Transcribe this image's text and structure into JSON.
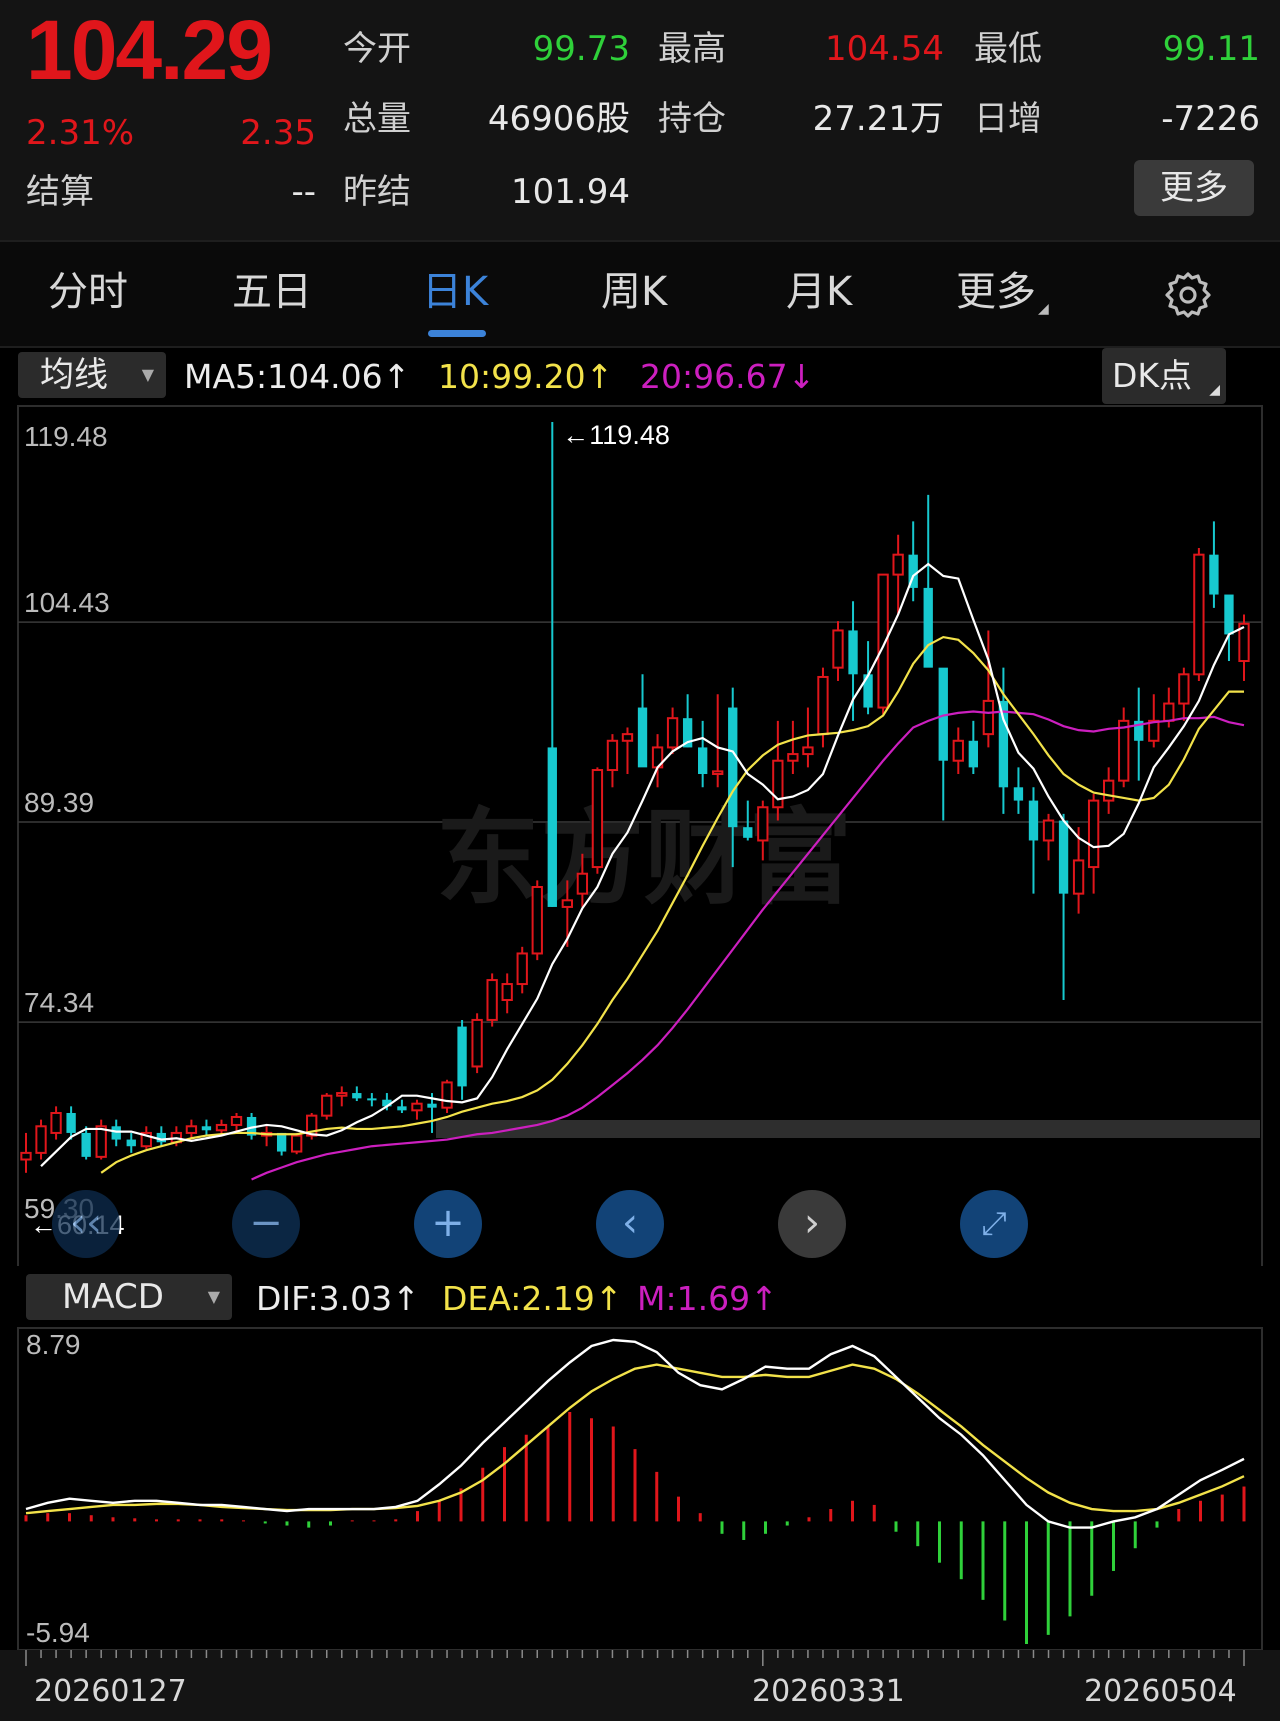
{
  "quote": {
    "price": "104.29",
    "change_pct": "2.31%",
    "change": "2.35",
    "open_label": "今开",
    "open": "99.73",
    "high_label": "最高",
    "high": "104.54",
    "low_label": "最低",
    "low": "99.11",
    "volume_label": "总量",
    "volume": "46906股",
    "position_label": "持仓",
    "position": "27.21万",
    "daily_inc_label": "日增",
    "daily_inc": "-7226",
    "settle_label": "结算",
    "settle": "--",
    "prev_settle_label": "昨结",
    "prev_settle": "101.94",
    "more_label": "更多"
  },
  "tabs": [
    {
      "label": "分时"
    },
    {
      "label": "五日"
    },
    {
      "label": "日K"
    },
    {
      "label": "周K"
    },
    {
      "label": "月K"
    },
    {
      "label": "更多"
    }
  ],
  "active_tab": "日K",
  "indicators": {
    "ma_select": "均线",
    "ma5": "MA5:104.06↑",
    "ma10": "10:99.20↑",
    "ma20": "20:96.67↓",
    "dk_label": "DK点",
    "macd_select": "MACD",
    "dif": "DIF:3.03↑",
    "dea": "DEA:2.19↑",
    "m": "M:1.69↑"
  },
  "price_axis": [
    "119.48",
    "104.43",
    "89.39",
    "74.34",
    "59.30"
  ],
  "macd_axis": [
    "8.79",
    "-5.94"
  ],
  "annotations": {
    "max_marker": "←119.48",
    "min_marker": "←60.14"
  },
  "dates": [
    "20260127",
    "20260331",
    "20260504"
  ],
  "colors": {
    "up": "#e0161b",
    "down": "#2fd13a",
    "cyan": "#17c9cf",
    "ma5": "#ffffff",
    "ma10": "#f2e24a",
    "ma20": "#cc1fbf",
    "accent": "#3c83d9"
  },
  "chart_data": [
    {
      "type": "candlestick",
      "title": "",
      "ylim": [
        59.3,
        119.48
      ],
      "candles": [
        [
          64,
          66,
          63,
          64.5
        ],
        [
          64.5,
          67,
          64,
          66.5
        ],
        [
          66,
          68,
          65.5,
          67.5
        ],
        [
          67.5,
          68,
          65.5,
          66
        ],
        [
          66,
          66.5,
          64,
          64.2
        ],
        [
          64.2,
          67,
          64,
          66.5
        ],
        [
          66.5,
          67,
          65,
          65.5
        ],
        [
          65.5,
          66,
          64.5,
          65
        ],
        [
          65,
          66.5,
          64.8,
          66
        ],
        [
          66,
          66.5,
          65,
          65.3
        ],
        [
          65.3,
          66.5,
          65,
          66
        ],
        [
          66,
          67,
          65.5,
          66.5
        ],
        [
          66.5,
          67,
          65.8,
          66.2
        ],
        [
          66.2,
          67,
          65.8,
          66.6
        ],
        [
          66.6,
          67.5,
          66,
          67.2
        ],
        [
          67.2,
          67.5,
          65.5,
          65.8
        ],
        [
          65.8,
          66.5,
          65,
          66
        ],
        [
          66,
          66,
          64.3,
          64.6
        ],
        [
          64.6,
          66,
          64.4,
          65.8
        ],
        [
          65.8,
          67.5,
          65.5,
          67.3
        ],
        [
          67.3,
          69,
          67,
          68.8
        ],
        [
          68.8,
          69.5,
          68,
          69
        ],
        [
          69,
          69.5,
          68.4,
          68.6
        ],
        [
          68.6,
          69,
          68,
          68.5
        ],
        [
          68.5,
          69,
          67.7,
          68
        ],
        [
          68,
          68.5,
          67.5,
          67.7
        ],
        [
          67.7,
          68.5,
          67,
          68.2
        ],
        [
          68.2,
          69,
          66,
          67.9
        ],
        [
          67.9,
          70,
          67.5,
          69.8
        ],
        [
          74,
          74.5,
          68.5,
          69.5
        ],
        [
          71,
          75,
          70.5,
          74.5
        ],
        [
          74.5,
          78,
          74,
          77.5
        ],
        [
          76,
          78,
          75,
          77.2
        ],
        [
          77.2,
          80,
          76.5,
          79.5
        ],
        [
          79.5,
          85,
          79,
          84.5
        ],
        [
          95,
          119.48,
          83,
          83
        ],
        [
          83,
          85,
          80,
          83.5
        ],
        [
          84,
          87,
          83,
          85.5
        ],
        [
          86,
          93.5,
          85.5,
          93.3
        ],
        [
          93.3,
          96,
          92,
          95.5
        ],
        [
          95.5,
          96.5,
          93,
          96
        ],
        [
          98,
          100.5,
          95,
          93.5
        ],
        [
          93.5,
          96,
          92,
          95
        ],
        [
          95,
          98,
          94.5,
          97.2
        ],
        [
          97.2,
          99,
          95,
          95
        ],
        [
          95,
          97,
          92,
          93
        ],
        [
          93,
          99,
          92,
          93.2
        ],
        [
          98,
          99.5,
          86,
          89
        ],
        [
          89,
          91,
          88,
          88.2
        ],
        [
          88,
          91,
          86.5,
          90.5
        ],
        [
          90.5,
          97,
          89.5,
          94
        ],
        [
          94,
          97,
          93,
          94.5
        ],
        [
          94.5,
          98,
          93.5,
          95
        ],
        [
          96,
          101,
          95,
          100.3
        ],
        [
          101,
          104.5,
          100,
          103.8
        ],
        [
          103.8,
          106,
          97,
          100.5
        ],
        [
          100.5,
          103,
          97.5,
          98
        ],
        [
          98,
          108,
          97.5,
          108
        ],
        [
          108,
          111,
          105,
          109.5
        ],
        [
          109.5,
          112,
          106,
          107
        ],
        [
          107,
          114,
          102,
          101
        ],
        [
          101,
          98,
          89.5,
          94
        ],
        [
          94,
          96.5,
          93,
          95.5
        ],
        [
          95.5,
          97,
          93,
          93.5
        ],
        [
          96,
          103.8,
          95,
          98.5
        ],
        [
          98.5,
          101,
          90,
          92
        ],
        [
          92,
          93.5,
          90,
          91
        ],
        [
          91,
          92,
          84,
          88
        ],
        [
          88,
          90,
          86.5,
          89.5
        ],
        [
          89.5,
          90,
          76,
          84
        ],
        [
          84,
          89,
          82.5,
          86.5
        ],
        [
          86,
          91.5,
          84,
          91
        ],
        [
          91,
          93.5,
          90,
          92.5
        ],
        [
          92.5,
          98,
          92,
          97
        ],
        [
          97,
          99.5,
          92.5,
          95.5
        ],
        [
          95.5,
          99,
          95,
          97
        ],
        [
          97,
          99.5,
          96.5,
          98.3
        ],
        [
          98.3,
          101,
          97,
          100.5
        ],
        [
          100.5,
          110,
          100,
          109.5
        ],
        [
          109.5,
          112,
          105.5,
          106.5
        ],
        [
          106.5,
          105,
          101.5,
          103.5
        ],
        [
          101.5,
          105,
          100,
          104.3
        ]
      ],
      "ma5": [
        63.5,
        64.6,
        65.7,
        66.3,
        66.3,
        66.1,
        66.1,
        65.8,
        65.5,
        65.6,
        65.4,
        65.6,
        65.8,
        66.1,
        66.4,
        66.6,
        66.5,
        66.2,
        65.9,
        65.8,
        66.2,
        66.8,
        67.3,
        68,
        68.8,
        68.8,
        68.6,
        68.4,
        68.3,
        68.6,
        70.2,
        72.3,
        74.2,
        76.1,
        78.7,
        80.6,
        82.9,
        84.5,
        87,
        88.6,
        91,
        93.5,
        94.7,
        95.4,
        95.7,
        95,
        94.7,
        93,
        92.2,
        91.1,
        91.3,
        91.8,
        93,
        95.9,
        98.6,
        100.4,
        102.6,
        105,
        107.9,
        108.8,
        107.9,
        107.7,
        104.6,
        101.6,
        97.1,
        94.6,
        93.4,
        91.3,
        89.5,
        88.2,
        87.5,
        87.6,
        88.5,
        90.8,
        93.5,
        95,
        96.6,
        98.5,
        101.2,
        103.5,
        104.06
      ],
      "ma10": [
        63,
        63.8,
        64.3,
        64.7,
        65,
        65.3,
        65.6,
        65.8,
        65.9,
        66,
        66,
        65.9,
        65.9,
        65.9,
        66.1,
        66.3,
        66.4,
        66.3,
        66.3,
        66.4,
        66.5,
        66.7,
        66.9,
        67.2,
        67.6,
        67.9,
        68.2,
        68.4,
        68.7,
        69.2,
        70,
        71.2,
        72.6,
        74.2,
        76,
        77.6,
        79.4,
        81.2,
        83.3,
        85.4,
        87.6,
        89.7,
        91.7,
        93.3,
        94.4,
        95.2,
        95.6,
        95.9,
        96,
        96.1,
        96.3,
        96.6,
        97.4,
        99.2,
        101.3,
        102.7,
        103.3,
        103.1,
        102.1,
        100.8,
        99,
        97.5,
        96,
        94.4,
        93,
        92.2,
        91.6,
        91.4,
        91.2,
        91,
        91.2,
        92.2,
        94.1,
        96.4,
        97.8,
        99.2,
        99.2
      ],
      "ma20": [
        62.5,
        63,
        63.4,
        63.8,
        64.1,
        64.4,
        64.6,
        64.8,
        65,
        65.1,
        65.2,
        65.3,
        65.4,
        65.5,
        65.7,
        65.9,
        66,
        66.2,
        66.4,
        66.6,
        66.9,
        67.3,
        67.9,
        68.7,
        69.6,
        70.5,
        71.5,
        72.6,
        73.9,
        75.3,
        76.8,
        78.3,
        79.8,
        81.3,
        82.8,
        84.2,
        85.6,
        87,
        88.4,
        89.8,
        91.2,
        92.6,
        94,
        95.3,
        96.5,
        97,
        97.4,
        97.6,
        97.7,
        97.6,
        97.7,
        97.6,
        97.5,
        97.1,
        96.6,
        96.3,
        96.2,
        96.4,
        96.5,
        96.7,
        96.9,
        97,
        97.2,
        97.2,
        97.3,
        96.9,
        96.67
      ]
    },
    {
      "type": "macd",
      "ylim": [
        -5.94,
        8.79
      ],
      "dif": [
        0.6,
        0.9,
        1.1,
        1.0,
        0.9,
        1.0,
        1.0,
        0.9,
        0.8,
        0.8,
        0.7,
        0.6,
        0.5,
        0.6,
        0.6,
        0.6,
        0.6,
        0.7,
        1.0,
        1.8,
        2.7,
        3.8,
        4.8,
        5.8,
        6.8,
        7.7,
        8.5,
        8.79,
        8.7,
        8.2,
        7.2,
        6.6,
        6.4,
        6.9,
        7.5,
        7.4,
        7.4,
        8.1,
        8.5,
        8.0,
        7.0,
        6.0,
        5.0,
        4.2,
        3.2,
        2.0,
        0.8,
        0.0,
        -0.3,
        -0.3,
        0.0,
        0.2,
        0.6,
        1.3,
        2.0,
        2.5,
        3.03
      ],
      "dea": [
        0.4,
        0.5,
        0.6,
        0.7,
        0.8,
        0.8,
        0.85,
        0.85,
        0.8,
        0.7,
        0.65,
        0.6,
        0.55,
        0.55,
        0.55,
        0.6,
        0.6,
        0.65,
        0.75,
        1.0,
        1.4,
        2.0,
        2.8,
        3.7,
        4.6,
        5.5,
        6.3,
        6.9,
        7.4,
        7.6,
        7.4,
        7.2,
        7.0,
        7.0,
        7.1,
        7.0,
        7.0,
        7.3,
        7.6,
        7.4,
        6.9,
        6.2,
        5.4,
        4.6,
        3.7,
        2.9,
        2.1,
        1.4,
        0.9,
        0.6,
        0.5,
        0.5,
        0.6,
        0.9,
        1.3,
        1.7,
        2.19
      ],
      "m": [
        0.3,
        0.4,
        0.4,
        0.3,
        0.2,
        0.15,
        0.1,
        0.1,
        0.1,
        0.1,
        0.05,
        -0.1,
        -0.2,
        -0.3,
        -0.2,
        0.05,
        0.05,
        0.1,
        0.5,
        1.0,
        1.6,
        2.6,
        3.6,
        4.2,
        4.6,
        5.3,
        5.0,
        4.6,
        3.5,
        2.4,
        1.2,
        0.4,
        -0.6,
        -0.9,
        -0.6,
        -0.2,
        0.2,
        0.6,
        1.0,
        0.8,
        -0.5,
        -1.2,
        -2.0,
        -2.8,
        -3.8,
        -4.8,
        -5.94,
        -5.5,
        -4.6,
        -3.6,
        -2.4,
        -1.3,
        -0.3,
        0.6,
        1.0,
        1.3,
        1.69
      ]
    }
  ]
}
